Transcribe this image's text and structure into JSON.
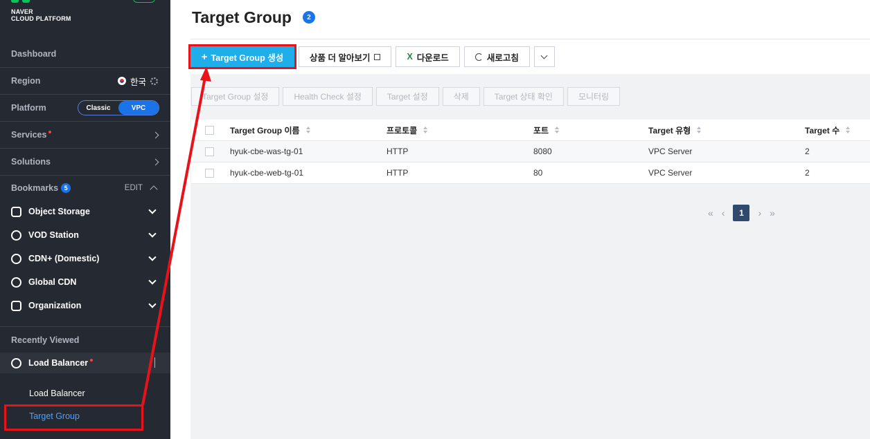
{
  "brand": {
    "line1": "NAVER",
    "line2": "CLOUD PLATFORM"
  },
  "sidebar": {
    "dashboard": "Dashboard",
    "region": {
      "label": "Region",
      "value": "한국"
    },
    "platform": {
      "label": "Platform",
      "options": [
        "Classic",
        "VPC"
      ],
      "selected": "VPC"
    },
    "services": "Services",
    "solutions": "Solutions",
    "bookmarks": {
      "label": "Bookmarks",
      "count": "5",
      "edit": "EDIT"
    },
    "bookmark_items": [
      "Object Storage",
      "VOD Station",
      "CDN+ (Domestic)",
      "Global CDN",
      "Organization"
    ],
    "recently_viewed": "Recently Viewed",
    "recent_group": "Load Balancer",
    "recent_sub": [
      "Load Balancer",
      "Target Group"
    ]
  },
  "main": {
    "title": "Target Group",
    "title_count": "2",
    "toolbar": {
      "create": "Target Group 생성",
      "learn_more": "상품 더 알아보기",
      "download": "다운로드",
      "refresh": "새로고침"
    },
    "actions": [
      "Target Group 설정",
      "Health Check 설정",
      "Target 설정",
      "삭제",
      "Target 상태 확인",
      "모니터링"
    ],
    "table": {
      "headers": [
        "Target Group 이름",
        "프로토콜",
        "포트",
        "Target 유형",
        "Target 수"
      ],
      "rows": [
        [
          "hyuk-cbe-was-tg-01",
          "HTTP",
          "8080",
          "VPC Server",
          "2"
        ],
        [
          "hyuk-cbe-web-tg-01",
          "HTTP",
          "80",
          "VPC Server",
          "2"
        ]
      ]
    },
    "pagination": {
      "current": "1"
    }
  },
  "colors": {
    "primary": "#1faee9",
    "accent": "#1a73e8",
    "highlight": "#e8121a",
    "sidebar_bg": "#252931"
  }
}
